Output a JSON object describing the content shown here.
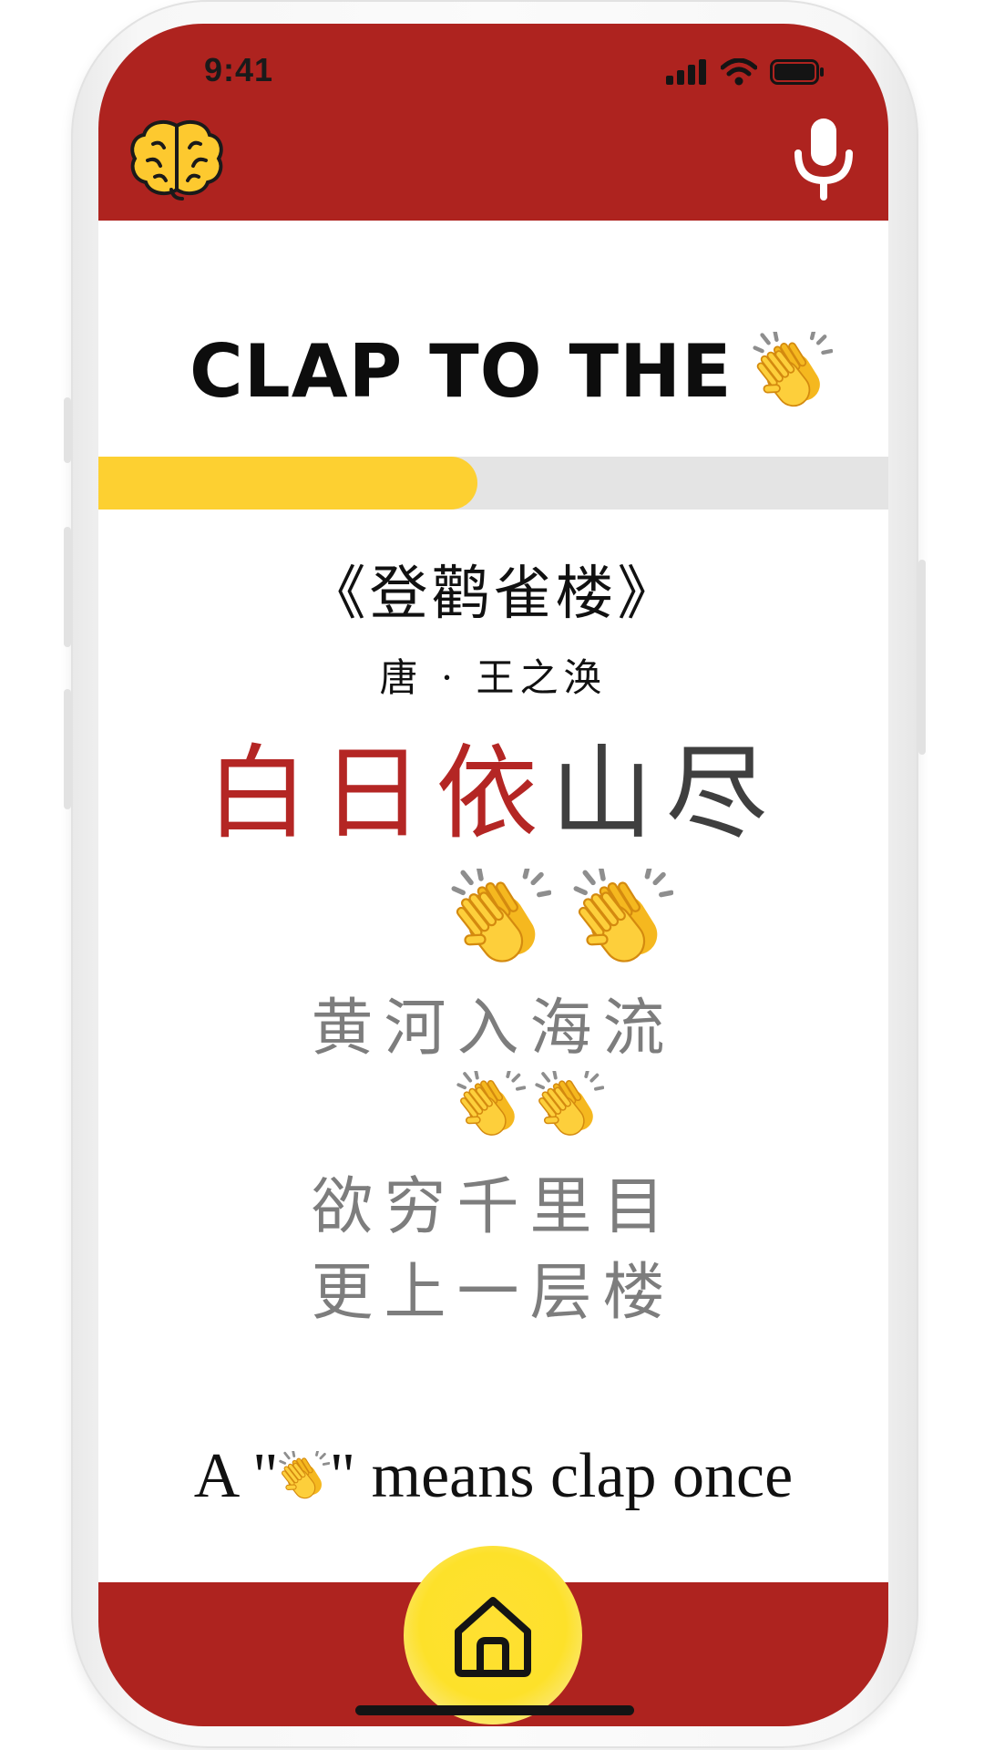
{
  "status_bar": {
    "time": "9:41"
  },
  "header": {
    "left_icon": "brain-icon",
    "right_icon": "microphone-icon",
    "background_color": "#ae231f"
  },
  "game": {
    "title": "CLAP TO THE",
    "title_icon": "clapping-hands-icon",
    "progress_fraction": 0.48
  },
  "poem": {
    "title": "《登鹳雀楼》",
    "author": "唐 · 王之涣",
    "active_line": {
      "done": [
        "白",
        "日",
        "依"
      ],
      "remaining": [
        "山",
        "尽"
      ]
    },
    "lines": [
      {
        "text": "白日依山尽",
        "claps_after": 2
      },
      {
        "text": "黄河入海流",
        "claps_after": 2
      },
      {
        "text": "欲穷千里目",
        "claps_after": 0
      },
      {
        "text": "更上一层楼",
        "claps_after": 0
      }
    ]
  },
  "hint": {
    "prefix": "A \"",
    "suffix": "\" means clap once",
    "icon": "clapping-hands-icon"
  },
  "nav": {
    "home_icon": "home-icon",
    "accent_color": "#fde12a"
  }
}
